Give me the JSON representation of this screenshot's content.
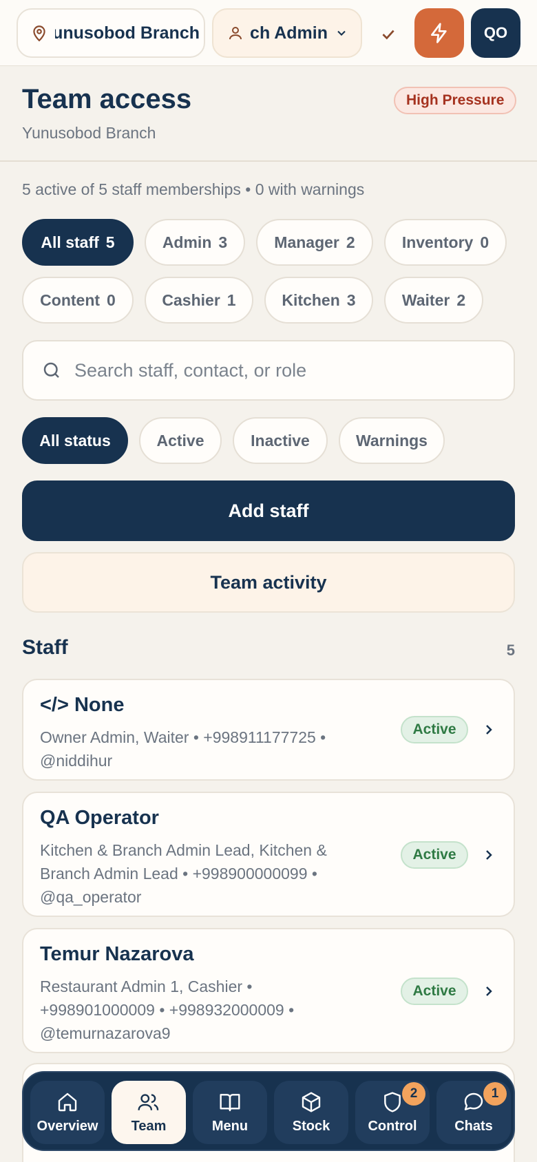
{
  "topbar": {
    "branch_label": "Yunusobod Branch",
    "role_label": "Branch Admin",
    "avatar_initials": "QO"
  },
  "header": {
    "title": "Team access",
    "subtitle": "Yunusobod Branch",
    "pressure_badge": "High Pressure",
    "summary": "5 active of 5 staff memberships • 0 with warnings"
  },
  "role_filters": [
    {
      "label": "All staff",
      "count": "5"
    },
    {
      "label": "Admin",
      "count": "3"
    },
    {
      "label": "Manager",
      "count": "2"
    },
    {
      "label": "Inventory",
      "count": "0"
    },
    {
      "label": "Content",
      "count": "0"
    },
    {
      "label": "Cashier",
      "count": "1"
    },
    {
      "label": "Kitchen",
      "count": "3"
    },
    {
      "label": "Waiter",
      "count": "2"
    }
  ],
  "search": {
    "placeholder": "Search staff, contact, or role",
    "value": ""
  },
  "status_filters": [
    "All status",
    "Active",
    "Inactive",
    "Warnings"
  ],
  "actions": {
    "add_staff": "Add staff",
    "team_activity": "Team activity"
  },
  "staff_section": {
    "title": "Staff",
    "count": "5",
    "items": [
      {
        "name": "</> None",
        "meta": "Owner Admin, Waiter • +998911177725 • @niddihur",
        "status": "Active"
      },
      {
        "name": "QA Operator",
        "meta": "Kitchen & Branch Admin Lead, Kitchen & Branch Admin Lead • +998900000099 • @qa_operator",
        "status": "Active"
      },
      {
        "name": "Temur Nazarova",
        "meta": "Restaurant Admin 1, Cashier • +998901000009 • +998932000009 • @temurnazarova9",
        "status": "Active"
      }
    ]
  },
  "bottom_nav": [
    {
      "label": "Overview",
      "icon": "home-icon"
    },
    {
      "label": "Team",
      "icon": "users-icon"
    },
    {
      "label": "Menu",
      "icon": "book-icon"
    },
    {
      "label": "Stock",
      "icon": "box-icon"
    },
    {
      "label": "Control",
      "icon": "shield-icon",
      "badge": "2"
    },
    {
      "label": "Chats",
      "icon": "chat-icon",
      "badge": "1"
    }
  ],
  "colors": {
    "primary": "#17324f",
    "accent": "#d4693a",
    "background": "#f5f2ec",
    "success": "#2f7a44",
    "danger": "#a5321f"
  }
}
